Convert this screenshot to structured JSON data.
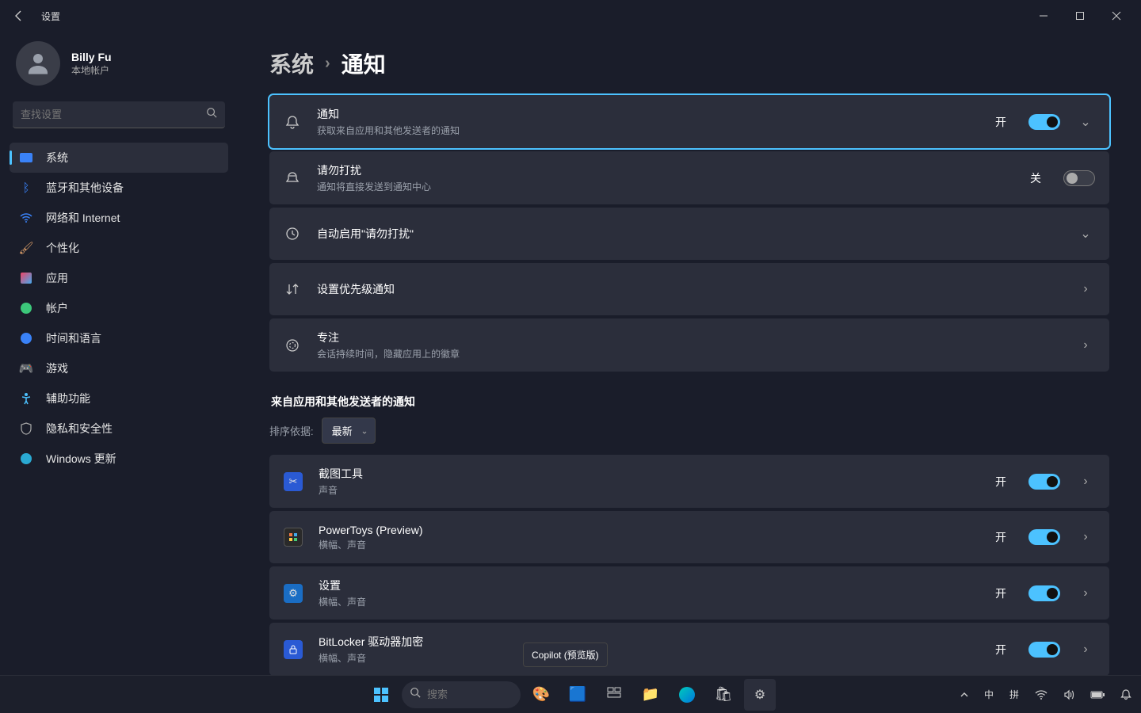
{
  "window": {
    "title": "设置"
  },
  "profile": {
    "name": "Billy Fu",
    "sub": "本地帐户"
  },
  "search": {
    "placeholder": "查找设置"
  },
  "sidebar": {
    "items": [
      {
        "label": "系统"
      },
      {
        "label": "蓝牙和其他设备"
      },
      {
        "label": "网络和 Internet"
      },
      {
        "label": "个性化"
      },
      {
        "label": "应用"
      },
      {
        "label": "帐户"
      },
      {
        "label": "时间和语言"
      },
      {
        "label": "游戏"
      },
      {
        "label": "辅助功能"
      },
      {
        "label": "隐私和安全性"
      },
      {
        "label": "Windows 更新"
      }
    ]
  },
  "breadcrumb": {
    "parent": "系统",
    "current": "通知"
  },
  "cards": {
    "notify": {
      "title": "通知",
      "sub": "获取来自应用和其他发送者的通知",
      "state": "开"
    },
    "dnd": {
      "title": "请勿打扰",
      "sub": "通知将直接发送到通知中心",
      "state": "关"
    },
    "autodnd": {
      "title": "自动启用\"请勿打扰\""
    },
    "priority": {
      "title": "设置优先级通知"
    },
    "focus": {
      "title": "专注",
      "sub": "会话持续时间，隐藏应用上的徽章"
    }
  },
  "section": {
    "title": "来自应用和其他发送者的通知",
    "sort_label": "排序依据:",
    "sort_value": "最新"
  },
  "app_list": [
    {
      "title": "截图工具",
      "sub": "声音",
      "state": "开"
    },
    {
      "title": "PowerToys (Preview)",
      "sub": "横幅、声音",
      "state": "开"
    },
    {
      "title": "设置",
      "sub": "横幅、声音",
      "state": "开"
    },
    {
      "title": "BitLocker 驱动器加密",
      "sub": "横幅、声音",
      "state": "开"
    }
  ],
  "tooltip": {
    "text": "Copilot (预览版)"
  },
  "taskbar": {
    "search_placeholder": "搜索",
    "tray": {
      "ime1": "中",
      "ime2": "拼"
    }
  }
}
